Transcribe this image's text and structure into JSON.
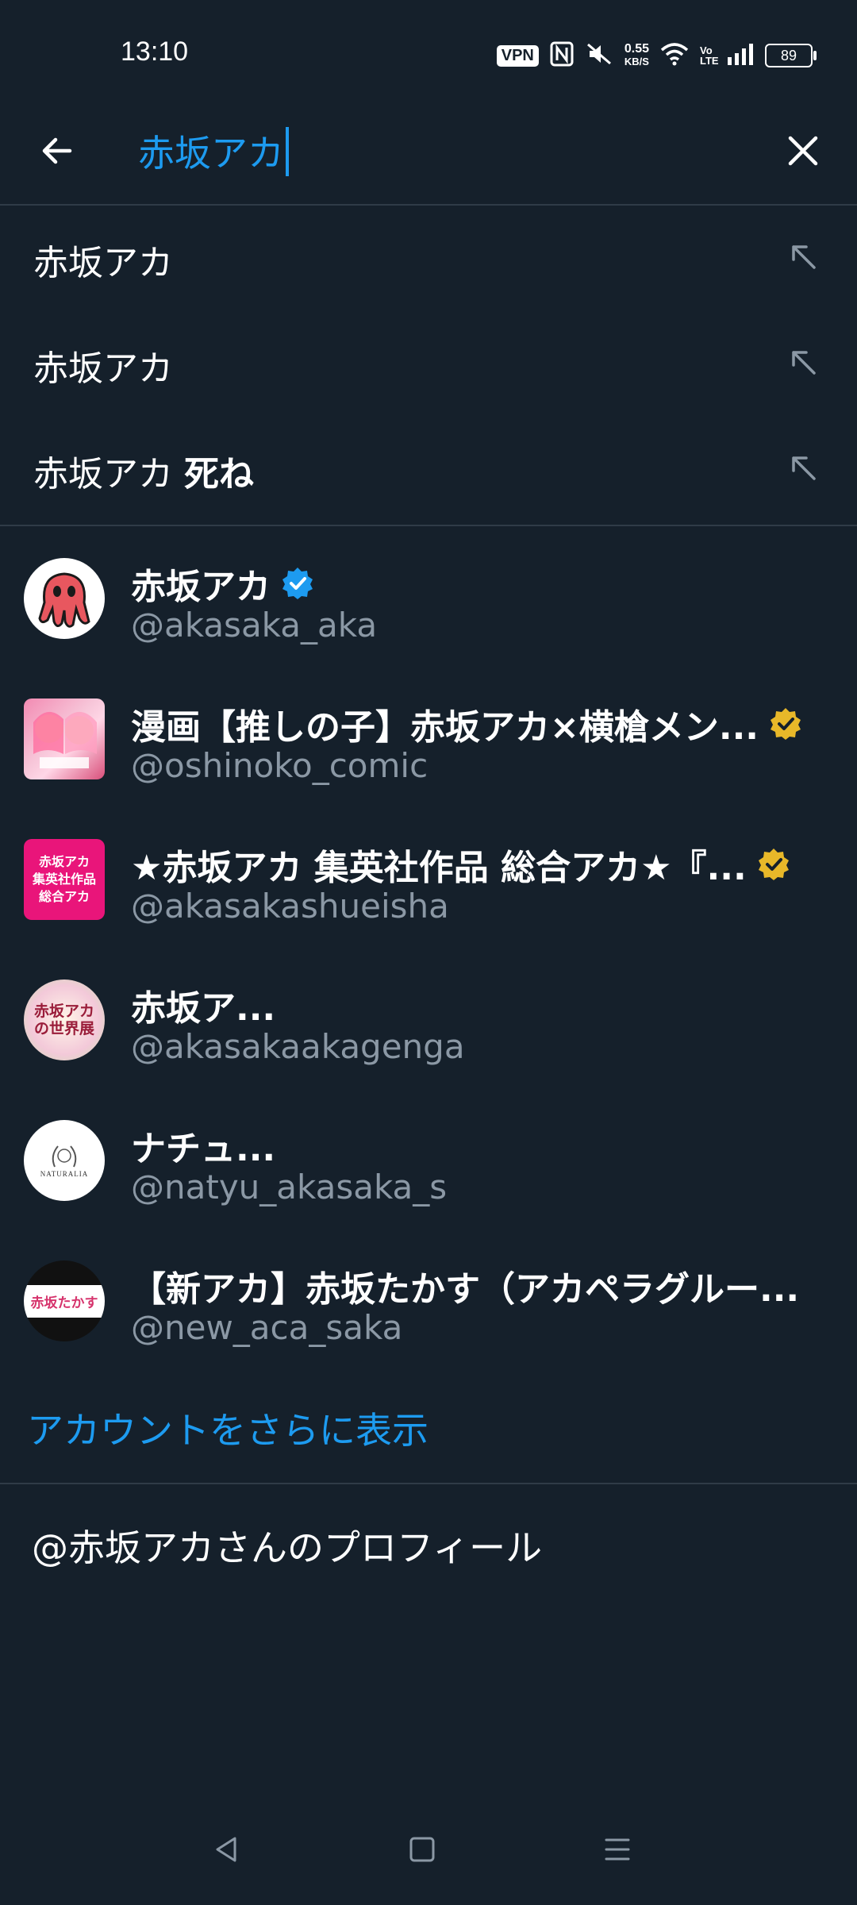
{
  "status_bar": {
    "time": "13:10",
    "vpn": "VPN",
    "speed_value": "0.55",
    "speed_unit": "KB/S",
    "network": "Vo LTE",
    "battery": "89"
  },
  "search": {
    "query": "赤坂アカ"
  },
  "suggestions": [
    {
      "prefix": "赤坂アカ",
      "bold": ""
    },
    {
      "prefix": "赤坂アカ",
      "bold": ""
    },
    {
      "prefix": "赤坂アカ ",
      "bold": "死ね"
    }
  ],
  "accounts": [
    {
      "name": "赤坂アカ",
      "handle": "@akasaka_aka",
      "verified": "blue"
    },
    {
      "name": "漫画【推しの子】赤坂アカ×横槍メン...",
      "handle": "@oshinoko_comic",
      "verified": "gold"
    },
    {
      "name": "★赤坂アカ 集英社作品 総合アカ★『...",
      "handle": "@akasakashueisha",
      "verified": "gold"
    },
    {
      "name": "赤坂ア...",
      "handle": "@akasakaakagenga",
      "verified": "none"
    },
    {
      "name": "ナチュ...",
      "handle": "@natyu_akasaka_s",
      "verified": "none"
    },
    {
      "name": "【新アカ】赤坂たかす（アカペラグルー...",
      "handle": "@new_aca_saka",
      "verified": "none"
    }
  ],
  "avatar_text": {
    "a3_line1": "赤坂アカ",
    "a3_line2": "集英社作品",
    "a3_line3": "総合アカ",
    "a4_line1": "赤坂アカ",
    "a4_line2": "の世界展",
    "a5_text": "NATURALIA",
    "a6_text": "赤坂たかす"
  },
  "show_more": "アカウントをさらに表示",
  "profile_link": "@赤坂アカさんのプロフィール",
  "colors": {
    "background": "#15202b",
    "accent": "#1d9bf0",
    "secondary_text": "#8b98a5",
    "divider": "#2f3b47",
    "gold_badge": "#e8b829"
  }
}
